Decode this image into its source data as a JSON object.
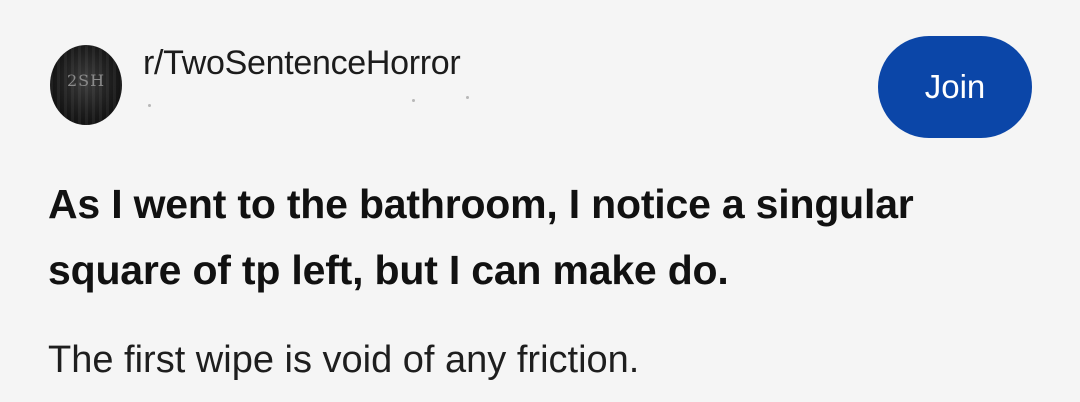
{
  "header": {
    "avatar_text": "2SH",
    "subreddit": "r/TwoSentenceHorror",
    "join_label": "Join"
  },
  "post": {
    "title": "As I went to the bathroom, I notice a singular square of tp left, but I can make do.",
    "body": "The first wipe is void of any friction."
  },
  "colors": {
    "join_button": "#0b46a8",
    "background": "#f5f5f5",
    "text": "#111111"
  }
}
